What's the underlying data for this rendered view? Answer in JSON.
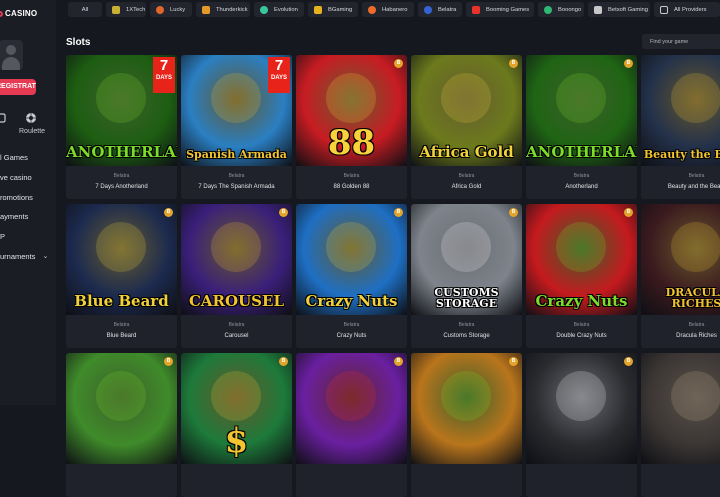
{
  "brand": {
    "logo_text": "CASINO",
    "accent": "#e63a53"
  },
  "sidebar": {
    "register_label": "REGISTRATION",
    "quick_links": [
      {
        "label": "",
        "icon": "slot-icon"
      },
      {
        "label": "Roulette",
        "icon": "roulette-icon"
      }
    ],
    "nav": [
      {
        "label": "l Games",
        "has_chevron": false
      },
      {
        "label": "ve casino",
        "has_chevron": false
      },
      {
        "label": "romotions",
        "has_chevron": false
      },
      {
        "label": "ayments",
        "has_chevron": false
      },
      {
        "label": "P",
        "has_chevron": false
      },
      {
        "label": "urnaments",
        "has_chevron": true
      }
    ]
  },
  "providers_bar": [
    {
      "label": "All",
      "icon": "",
      "color": ""
    },
    {
      "label": "1XTech",
      "icon": "1xtech-icon",
      "color": "#c9b033"
    },
    {
      "label": "Lucky",
      "icon": "lucky-icon",
      "color": "#e0662c"
    },
    {
      "label": "Thunderkick",
      "icon": "thunderkick-icon",
      "color": "#e39a28"
    },
    {
      "label": "Evolution",
      "icon": "evolution-icon",
      "color": "#38c79a"
    },
    {
      "label": "BGaming",
      "icon": "bgaming-icon",
      "color": "#e3b31f"
    },
    {
      "label": "Habanero",
      "icon": "habanero-icon",
      "color": "#ef6b2a"
    },
    {
      "label": "Belatra",
      "icon": "belatra-icon",
      "color": "#3563d6"
    },
    {
      "label": "Booming Games",
      "icon": "booming-icon",
      "color": "#e8332d"
    },
    {
      "label": "Booongo",
      "icon": "booongo-icon",
      "color": "#2fb871"
    },
    {
      "label": "Betsoft Gaming",
      "icon": "betsoft-icon",
      "color": "#c7c7c7"
    },
    {
      "label": "All Providers",
      "icon": "all-providers-icon",
      "color": "#c9cad0"
    }
  ],
  "main": {
    "section_title": "Slots",
    "search_placeholder": "Find your game"
  },
  "games": [
    {
      "provider": "Belatra",
      "name": "7 Days Anotherland",
      "art_text": "ANOTHERLAND",
      "days": "7",
      "days_text": "DAYS",
      "bg": "#1d5e12",
      "fg": "#7bdc2a"
    },
    {
      "provider": "Belatra",
      "name": "7 Days The Spanish Armada",
      "art_text": "Spanish Armada",
      "days": "7",
      "days_text": "DAYS",
      "bg": "#2a7fc2",
      "fg": "#f2c431"
    },
    {
      "provider": "Belatra",
      "name": "88 Golden 88",
      "art_text": "88",
      "days": "",
      "days_text": "",
      "bg": "#c81c22",
      "fg": "#f8d23a"
    },
    {
      "provider": "Belatra",
      "name": "Africa Gold",
      "art_text": "Africa Gold",
      "days": "",
      "days_text": "",
      "bg": "#6c7a1c",
      "fg": "#f0d23b"
    },
    {
      "provider": "Belatra",
      "name": "Anotherland",
      "art_text": "ANOTHERLAND",
      "days": "",
      "days_text": "",
      "bg": "#1f6414",
      "fg": "#7bdc2a"
    },
    {
      "provider": "Belatra",
      "name": "Beauty and the Beast",
      "art_text": "Beauty the Beast",
      "days": "",
      "days_text": "",
      "bg": "#23314a",
      "fg": "#f2c431"
    },
    {
      "provider": "Belatra",
      "name": "Blue Beard",
      "art_text": "Blue Beard",
      "days": "",
      "days_text": "",
      "bg": "#1c2a4e",
      "fg": "#f2d23b"
    },
    {
      "provider": "Belatra",
      "name": "Carousel",
      "art_text": "CAROUSEL",
      "days": "",
      "days_text": "",
      "bg": "#3a1f7a",
      "fg": "#f2c431"
    },
    {
      "provider": "Belatra",
      "name": "Crazy Nuts",
      "art_text": "Crazy Nuts",
      "days": "",
      "days_text": "",
      "bg": "#1e6fc4",
      "fg": "#f2d23b"
    },
    {
      "provider": "Belatra",
      "name": "Customs Storage",
      "art_text": "CUSTOMS STORAGE",
      "days": "",
      "days_text": "",
      "bg": "#7e848c",
      "fg": "#ffffff"
    },
    {
      "provider": "Belatra",
      "name": "Double Crazy Nuts",
      "art_text": "Crazy Nuts",
      "days": "",
      "days_text": "",
      "bg": "#c51a1e",
      "fg": "#7bdc2a"
    },
    {
      "provider": "Belatra",
      "name": "Dracula Riches",
      "art_text": "DRACULA RICHES",
      "days": "",
      "days_text": "",
      "bg": "#3b1a1e",
      "fg": "#f2c431"
    },
    {
      "provider": "",
      "name": "",
      "art_text": "",
      "days": "",
      "days_text": "",
      "bg": "#3f8b2a",
      "fg": "#7bdc2a"
    },
    {
      "provider": "",
      "name": "",
      "art_text": "$",
      "days": "",
      "days_text": "",
      "bg": "#1d7a3a",
      "fg": "#f2c431"
    },
    {
      "provider": "",
      "name": "",
      "art_text": "",
      "days": "",
      "days_text": "",
      "bg": "#6a1fa0",
      "fg": "#e8332d"
    },
    {
      "provider": "",
      "name": "",
      "art_text": "",
      "days": "",
      "days_text": "",
      "bg": "#b9751c",
      "fg": "#7bdc2a"
    },
    {
      "provider": "",
      "name": "",
      "art_text": "",
      "days": "",
      "days_text": "",
      "bg": "#2a2b2f",
      "fg": "#ffffff"
    },
    {
      "provider": "",
      "name": "",
      "art_text": "",
      "days": "",
      "days_text": "",
      "bg": "#3b3634",
      "fg": "#c9b08a"
    }
  ]
}
